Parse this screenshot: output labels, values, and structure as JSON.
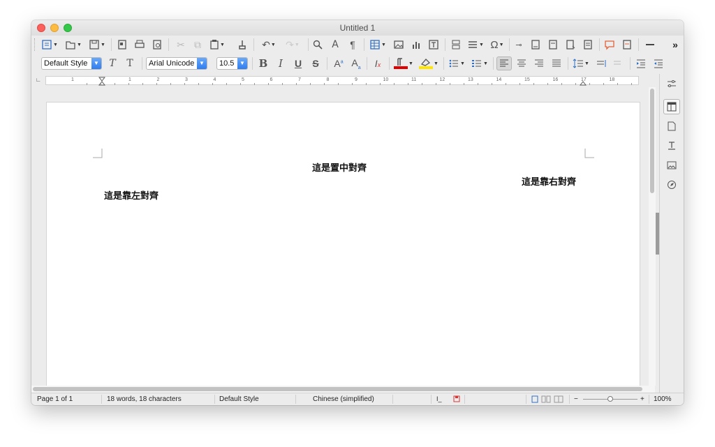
{
  "window": {
    "title": "Untitled 1"
  },
  "toolbar2": {
    "paragraph_style": "Default Style",
    "font_name": "Arial Unicode M",
    "font_size": "10.5",
    "bold_label": "B",
    "italic_label": "I",
    "underline_label": "U",
    "strike_label": "S"
  },
  "icons": {
    "toolbar1": [
      "new-document-icon",
      "open-icon",
      "save-icon",
      "export-pdf-icon",
      "print-icon",
      "print-preview-icon",
      "cut-icon",
      "copy-icon",
      "paste-icon",
      "clone-formatting-icon",
      "undo-icon",
      "redo-icon",
      "find-replace-icon",
      "spelling-icon",
      "formatting-marks-icon",
      "insert-table-icon",
      "insert-image-icon",
      "insert-chart-icon",
      "insert-textbox-icon",
      "page-break-icon",
      "insert-field-icon",
      "special-character-icon",
      "hyperlink-icon",
      "footnote-icon",
      "endnote-icon",
      "bookmark-icon",
      "cross-reference-icon",
      "comment-icon",
      "track-changes-icon",
      "horizontal-line-icon",
      "more-icon"
    ],
    "sidebar": [
      "properties-icon",
      "styles-icon",
      "gallery-icon",
      "navigator-icon",
      "image-icon",
      "compass-icon"
    ]
  },
  "ruler": {
    "numbers": [
      "1",
      "1",
      "2",
      "3",
      "4",
      "5",
      "6",
      "7",
      "8",
      "9",
      "10",
      "11",
      "12",
      "13",
      "14",
      "15",
      "16",
      "17",
      "18"
    ]
  },
  "document": {
    "center_text": "這是置中對齊",
    "right_text": "這是靠右對齊",
    "left_text": "這是靠左對齊"
  },
  "statusbar": {
    "page": "Page 1 of 1",
    "words": "18 words, 18 characters",
    "style": "Default Style",
    "language": "Chinese (simplified)",
    "zoom_minus": "−",
    "zoom_plus": "+",
    "zoom": "100%"
  },
  "colors": {
    "font_color": "#e00000",
    "highlight_color": "#ffe600",
    "accent": "#2f7df0"
  }
}
